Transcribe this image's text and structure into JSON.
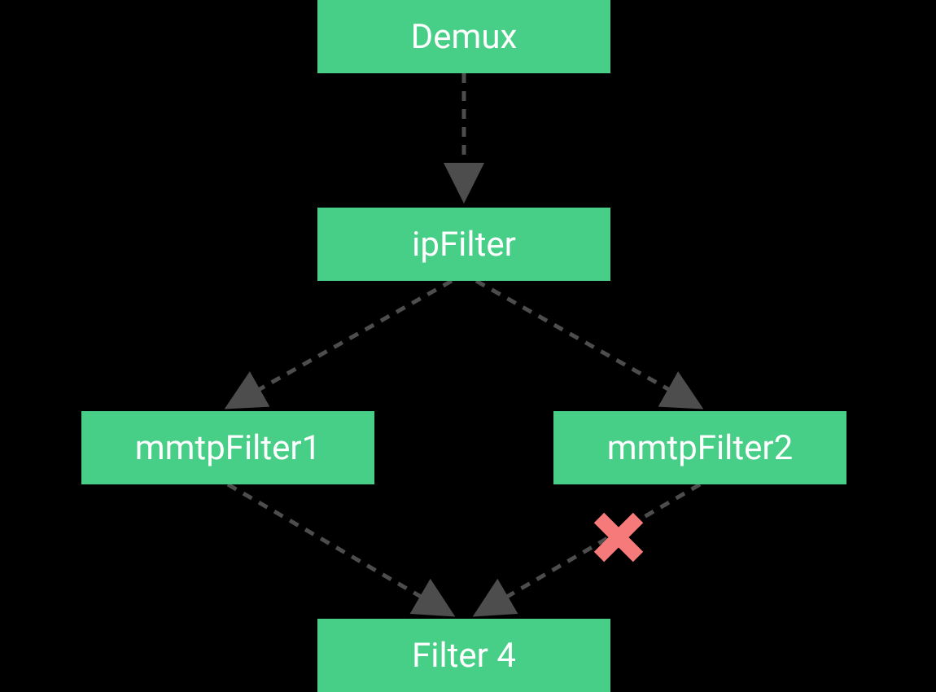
{
  "diagram": {
    "nodes": {
      "demux": {
        "label": "Demux"
      },
      "ipFilter": {
        "label": "ipFilter"
      },
      "mmtpFilter1": {
        "label": "mmtpFilter1"
      },
      "mmtpFilter2": {
        "label": "mmtpFilter2"
      },
      "filter4": {
        "label": "Filter 4"
      }
    },
    "edges": [
      {
        "from": "demux",
        "to": "ipFilter"
      },
      {
        "from": "ipFilter",
        "to": "mmtpFilter1"
      },
      {
        "from": "ipFilter",
        "to": "mmtpFilter2"
      },
      {
        "from": "mmtpFilter1",
        "to": "filter4"
      },
      {
        "from": "mmtpFilter2",
        "to": "filter4",
        "blocked": true
      }
    ],
    "colors": {
      "nodeBackground": "#47CE87",
      "nodeText": "#ffffff",
      "edgeColor": "#4D4D4D",
      "crossColor": "#F77A7A",
      "background": "#000000"
    }
  }
}
